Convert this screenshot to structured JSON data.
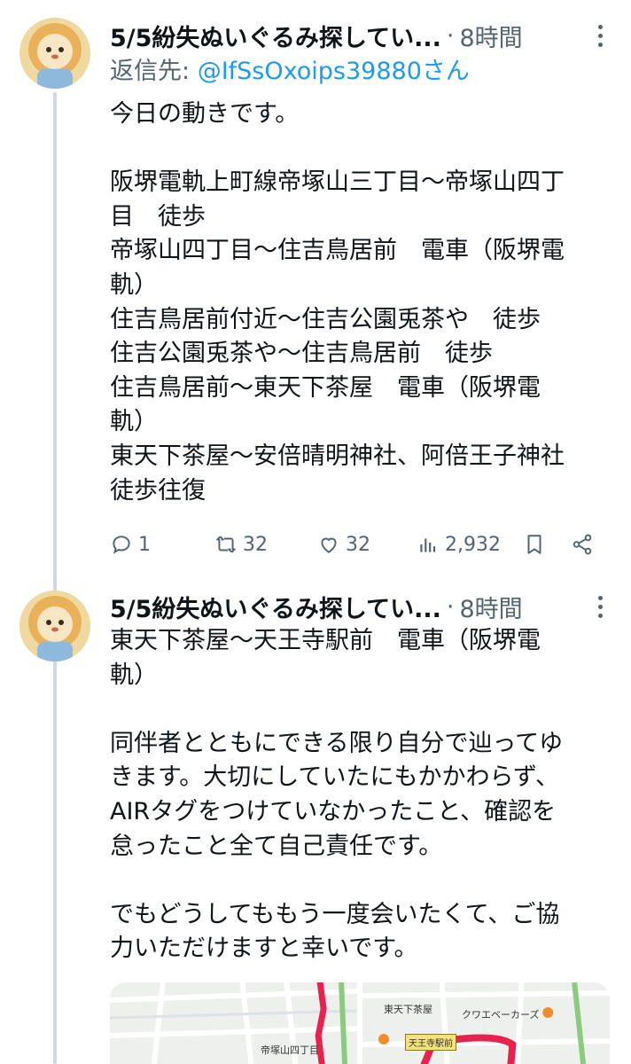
{
  "tweets": [
    {
      "author_name": "5/5紛失ぬいぐるみ探してい...",
      "separator": "·",
      "time": "8時間",
      "reply_prefix": "返信先: ",
      "reply_handle": "@IfSsOxoips39880さん",
      "lines": [
        "今日の動きです。",
        "",
        "阪堺電軌上町線帝塚山三丁目～帝塚山四丁",
        "目　徒歩",
        "帝塚山四丁目～住吉鳥居前　電車（阪堺電",
        "軌）",
        "住吉鳥居前付近～住吉公園兎茶や　徒歩",
        "住吉公園兎茶や～住吉鳥居前　徒歩",
        "住吉鳥居前～東天下茶屋　電車（阪堺電",
        "軌）",
        "東天下茶屋～安倍晴明神社、阿倍王子神社",
        "徒歩往復"
      ],
      "actions": {
        "replies": "1",
        "retweets": "32",
        "likes": "32",
        "views": "2,932"
      }
    },
    {
      "author_name": "5/5紛失ぬいぐるみ探してい...",
      "separator": "·",
      "time": "8時間",
      "lines": [
        "東天下茶屋～天王寺駅前　電車（阪堺電",
        "軌）",
        "",
        "同伴者とともにできる限り自分で辿ってゆ",
        "きます。大切にしていたにもかかわらず、",
        "AIRタグをつけていなかったこと、確認を",
        "怠ったこと全て自己責任です。",
        "",
        "でもどうしてももう一度会いたくて、ご協",
        "力いただけますと幸いです。"
      ],
      "media": {
        "map1_label": "帝塚山四丁目",
        "map2_label_station": "東天下茶屋",
        "map2_label_shop": "クワエベーカーズ",
        "map2_label_box": "天王寺駅前"
      }
    }
  ],
  "colors": {
    "link": "#1d9bf0",
    "secondary": "#536471",
    "thread_line": "#cfd9de",
    "route": "#e8224f"
  },
  "icons": [
    "reply-icon",
    "retweet-icon",
    "like-icon",
    "views-icon",
    "bookmark-icon",
    "share-icon",
    "more-icon"
  ]
}
